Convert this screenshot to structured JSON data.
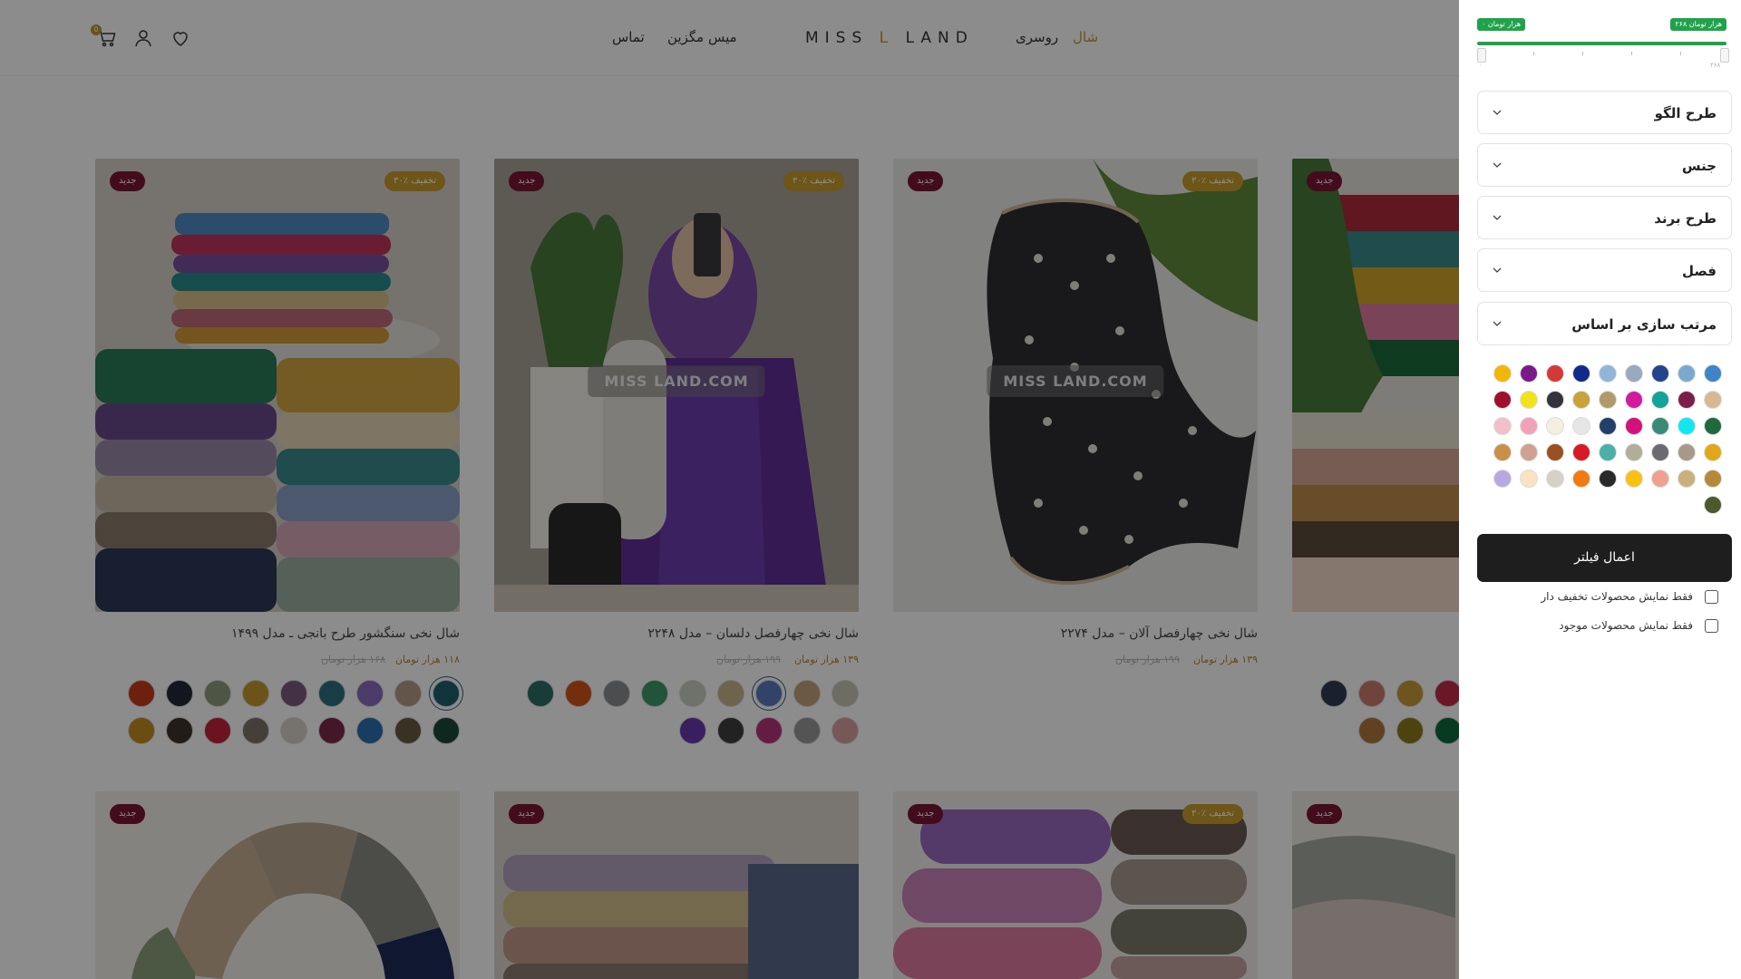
{
  "header": {
    "nav": {
      "shawl": "شال",
      "scarf": "روسری",
      "magazine": "میس مگزین",
      "contact": "تماس"
    },
    "logo": {
      "left": "MISS",
      "mid": "L",
      "right": "LAND"
    },
    "cart_count": "0",
    "icons": {
      "cart": "cart-icon",
      "user": "user-icon",
      "wishlist": "heart-icon"
    },
    "accent": "#c4962a"
  },
  "products": [
    {
      "title": "شال نخی سنگشور طرح بانجی ـ مدل ۱۴۹۹",
      "price": "۱۱۸ هزار تومان",
      "old_price": "۱۶۸ هزار تومان",
      "badge_new": "جدید",
      "badge_off": "۳۰٪ تخفیف",
      "watermark": "",
      "swatch_colors_row1": [
        "#1f5f6d",
        "#b49b86",
        "#8a6bbf",
        "#2e6f7e",
        "#7e5a80",
        "#c59a2e",
        "#8e9b7d",
        "#232938",
        "#c93b1c"
      ],
      "swatch_colors_row2": [
        "#1b4a3a",
        "#6b5a44",
        "#2a6fb0",
        "#7a2a48",
        "#d8d2c6",
        "#7d7466",
        "#c4243c",
        "#3c342c",
        "#c48a20"
      ]
    },
    {
      "title": "شال نخی چهارفصل دلسان – مدل ۲۲۴۸",
      "price": "۱۳۹ هزار تومان",
      "old_price": "۱۹۹ هزار تومان",
      "badge_new": "جدید",
      "badge_off": "۳۰٪ تخفیف",
      "watermark": "MISS LAND.COM",
      "swatch_colors_row1": [
        "#c9c6b6",
        "#c4a27c",
        "#5a7ac0",
        "#c9b48a",
        "#c8cfc0",
        "#3c9a6a",
        "#8a8c8e",
        "#d4541a",
        "#2c6e66"
      ],
      "swatch_colors_row2": [
        "#d9a0a0",
        "#9a9a9a",
        "#b8347a",
        "#3e3e3e",
        "#6a3ab0"
      ]
    },
    {
      "title": "شال نخی چهارفصل آلان – مدل ۲۲۷۴",
      "price": "۱۳۹ هزار تومان",
      "old_price": "۱۹۹ هزار تومان",
      "badge_new": "جدید",
      "badge_off": "۳۰٪ تخفیف",
      "watermark": "MISS LAND.COM",
      "swatch_colors_row1": [],
      "swatch_colors_row2": []
    },
    {
      "title": "",
      "price": "",
      "old_price": "",
      "badge_new": "جدید",
      "badge_off": "",
      "watermark": "",
      "swatch_colors_row1": [
        "#c42a4a",
        "#c8993a",
        "#cc7a70",
        "#2e3c54"
      ],
      "swatch_colors_row2": [
        "#0e6a3a",
        "#8a7a1a",
        "#b07840"
      ]
    },
    {
      "title": "",
      "price": "",
      "old_price": "",
      "badge_new": "جدید",
      "badge_off": "",
      "watermark": "",
      "swatch_colors_row1": [],
      "swatch_colors_row2": []
    },
    {
      "title": "",
      "price": "",
      "old_price": "",
      "badge_new": "جدید",
      "badge_off": "",
      "watermark": "",
      "swatch_colors_row1": [],
      "swatch_colors_row2": []
    },
    {
      "title": "",
      "price": "",
      "old_price": "",
      "badge_new": "جدید",
      "badge_off": "۳۰٪ تخفیف",
      "watermark": "",
      "swatch_colors_row1": [],
      "swatch_colors_row2": []
    },
    {
      "title": "",
      "price": "",
      "old_price": "",
      "badge_new": "جدید",
      "badge_off": "",
      "watermark": "",
      "swatch_colors_row1": [],
      "swatch_colors_row2": []
    }
  ],
  "filter": {
    "price_max": "۲۶۸ هزار تومان",
    "price_min": "۰ هزار تومان",
    "range_min_label": "۰",
    "range_max_label": "۲۶۸",
    "accordions": [
      "طرح الگو",
      "جنس",
      "طرح برند",
      "فصل",
      "مرتب سازی بر اساس"
    ],
    "colors": [
      [
        "#3f84c8",
        "#7aa9cf",
        "#23438c",
        "#9aa8c0",
        "#8fb6d8",
        "#102a8a",
        "#d23a3a",
        "#7a1a8a",
        "#f2b705"
      ],
      [
        "#d8b890",
        "#7a1f4a",
        "#12a39a",
        "#d21aa0",
        "#b09a6a",
        "#c9a23a",
        "#333340",
        "#f2e21a",
        "#a0102a"
      ],
      [
        "#1e6a3e",
        "#12e6f0",
        "#3a8a78",
        "#d2127a",
        "#22406a",
        "#e6e6e6",
        "#f6eee0",
        "#f2a2b8",
        "#f2c0c8"
      ],
      [
        "#e0a818",
        "#a89888",
        "#6a6a70",
        "#b0ae9a",
        "#4ab0a8",
        "#d81a24",
        "#9a5020",
        "#d0a090",
        "#c8904a"
      ],
      [
        "#b48a3a",
        "#c8b078",
        "#f0a090",
        "#f6c212",
        "#2a2a2a",
        "#f27a10",
        "#d4d2c4",
        "#fbe2c0",
        "#b6a8e0"
      ],
      [
        "#4a5a2a"
      ]
    ],
    "apply_label": "اعمال فیلتر",
    "only_discounted": "فقط نمایش محصولات تخفیف دار",
    "only_available": "فقط نمایش محصولات موجود",
    "accent": "#1fa34a"
  }
}
